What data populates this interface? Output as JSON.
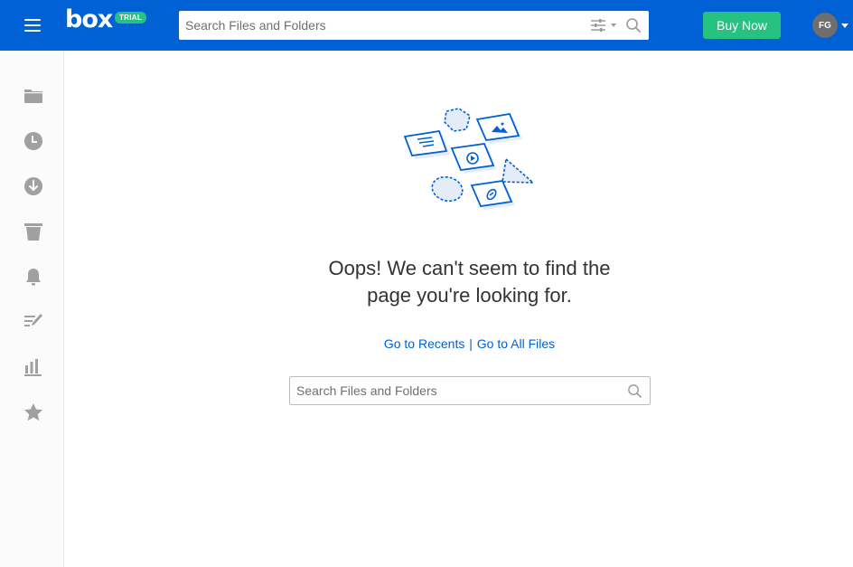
{
  "header": {
    "logo_text": "box",
    "trial_badge": "TRIAL",
    "search_placeholder": "Search Files and Folders",
    "buy_now_label": "Buy Now",
    "avatar_initials": "FG"
  },
  "sidebar": {
    "items": [
      {
        "name": "all-files",
        "icon": "folder-icon"
      },
      {
        "name": "recents",
        "icon": "clock-icon"
      },
      {
        "name": "synced",
        "icon": "download-icon"
      },
      {
        "name": "trash",
        "icon": "trash-icon"
      },
      {
        "name": "notifications",
        "icon": "bell-icon"
      },
      {
        "name": "notes",
        "icon": "notes-icon"
      },
      {
        "name": "admin-console",
        "icon": "bar-chart-icon"
      },
      {
        "name": "favorites",
        "icon": "star-icon"
      }
    ]
  },
  "main": {
    "error_line1": "Oops! We can't seem to find the",
    "error_line2": "page you're looking for.",
    "link_recents": "Go to Recents",
    "link_separator": "|",
    "link_all_files": "Go to All Files",
    "search_placeholder": "Search Files and Folders"
  },
  "colors": {
    "brand": "#0061d5",
    "buy_now": "#26c281",
    "sidebar_icon": "#9e9e9e"
  }
}
